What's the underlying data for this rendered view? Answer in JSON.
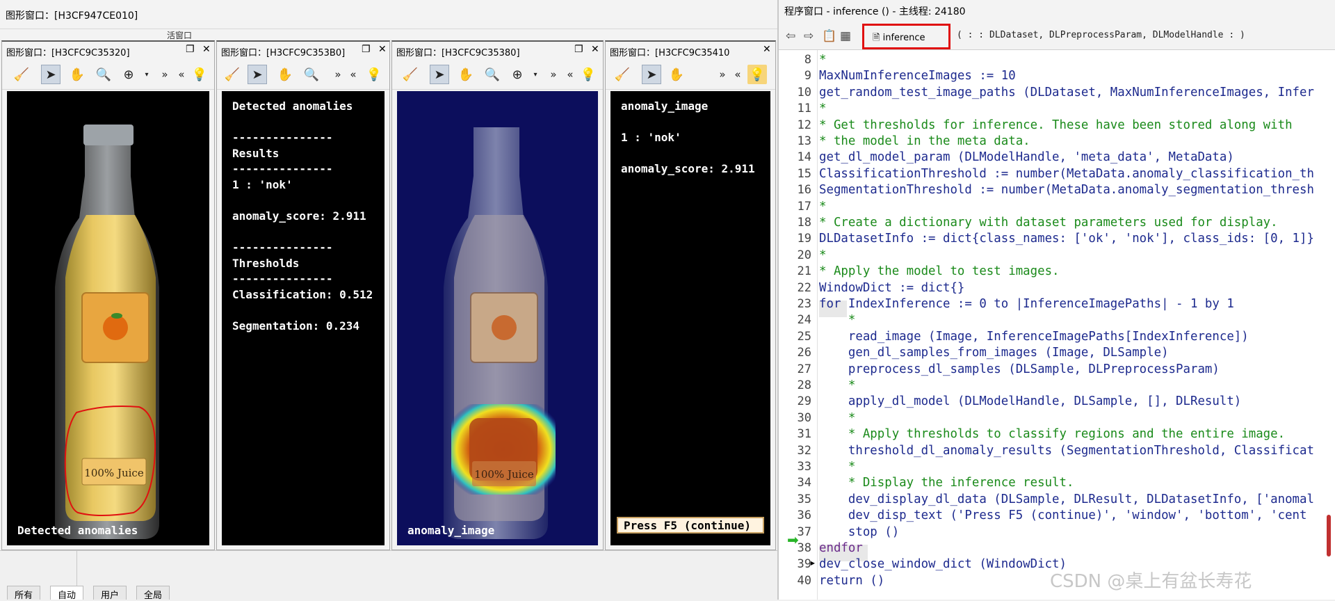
{
  "bg": {
    "title": "图形窗口：[H3CF947CE010]",
    "partial_label": "活窗口"
  },
  "windows": [
    {
      "title": "图形窗口：[H3CFC9C35320]",
      "caption": "Detected anomalies"
    },
    {
      "title": "图形窗口：[H3CFC9C353B0]",
      "lines": [
        "Detected anomalies",
        "",
        "---------------",
        "Results",
        "---------------",
        "1 : 'nok'",
        "",
        "anomaly_score: 2.911",
        "",
        "---------------",
        "Thresholds",
        "---------------",
        "Classification: 0.512",
        "",
        "Segmentation: 0.234"
      ]
    },
    {
      "title": "图形窗口：[H3CFC9C35380]",
      "caption": "anomaly_image"
    },
    {
      "title": "图形窗口：[H3CFC9C35410",
      "lines": [
        "anomaly_image",
        "",
        "1 : 'nok'",
        "",
        "anomaly_score: 2.911"
      ],
      "button": "Press F5 (continue)"
    }
  ],
  "bottom_tabs": [
    "所有",
    "自动",
    "用户",
    "全局"
  ],
  "bottle": {
    "label": "100% Juice"
  },
  "program": {
    "title": "程序窗口 - inference () - 主线程: 24180",
    "proc_name": "inference",
    "signature": "( : : DLDataset, DLPreprocessParam, DLModelHandle : )",
    "lines": [
      {
        "n": "8",
        "t": "*",
        "c": "cm"
      },
      {
        "n": "9",
        "t": "MaxNumInferenceImages := 10",
        "c": "var"
      },
      {
        "n": "10",
        "t": "get_random_test_image_paths (DLDataset, MaxNumInferenceImages, Infer",
        "c": "var"
      },
      {
        "n": "11",
        "t": "*",
        "c": "cm"
      },
      {
        "n": "12",
        "t": "* Get thresholds for inference. These have been stored along with",
        "c": "cm"
      },
      {
        "n": "13",
        "t": "* the model in the meta data.",
        "c": "cm"
      },
      {
        "n": "14",
        "t": "get_dl_model_param (DLModelHandle, 'meta_data', MetaData)",
        "c": "var"
      },
      {
        "n": "15",
        "t": "ClassificationThreshold := number(MetaData.anomaly_classification_th",
        "c": "var"
      },
      {
        "n": "16",
        "t": "SegmentationThreshold := number(MetaData.anomaly_segmentation_thresh",
        "c": "var"
      },
      {
        "n": "17",
        "t": "*",
        "c": "cm"
      },
      {
        "n": "18",
        "t": "* Create a dictionary with dataset parameters used for display.",
        "c": "cm"
      },
      {
        "n": "19",
        "t": "DLDatasetInfo := dict{class_names: ['ok', 'nok'], class_ids: [0, 1]}",
        "c": "var"
      },
      {
        "n": "20",
        "t": "*",
        "c": "cm"
      },
      {
        "n": "21",
        "t": "* Apply the model to test images.",
        "c": "cm"
      },
      {
        "n": "22",
        "t": "WindowDict := dict{}",
        "c": "var"
      },
      {
        "n": "23",
        "t": "for IndexInference := 0 to |InferenceImagePaths| - 1 by 1",
        "c": "var"
      },
      {
        "n": "24",
        "t": "    *",
        "c": "cm"
      },
      {
        "n": "25",
        "t": "    read_image (Image, InferenceImagePaths[IndexInference])",
        "c": "var"
      },
      {
        "n": "26",
        "t": "    gen_dl_samples_from_images (Image, DLSample)",
        "c": "var"
      },
      {
        "n": "27",
        "t": "    preprocess_dl_samples (DLSample, DLPreprocessParam)",
        "c": "var"
      },
      {
        "n": "28",
        "t": "    *",
        "c": "cm"
      },
      {
        "n": "29",
        "t": "    apply_dl_model (DLModelHandle, DLSample, [], DLResult)",
        "c": "var"
      },
      {
        "n": "30",
        "t": "    *",
        "c": "cm"
      },
      {
        "n": "31",
        "t": "    * Apply thresholds to classify regions and the entire image.",
        "c": "cm"
      },
      {
        "n": "32",
        "t": "    threshold_dl_anomaly_results (SegmentationThreshold, Classificat",
        "c": "var"
      },
      {
        "n": "33",
        "t": "    *",
        "c": "cm"
      },
      {
        "n": "34",
        "t": "    * Display the inference result.",
        "c": "cm"
      },
      {
        "n": "35",
        "t": "    dev_display_dl_data (DLSample, DLResult, DLDatasetInfo, ['anomal",
        "c": "var"
      },
      {
        "n": "36",
        "t": "    dev_disp_text ('Press F5 (continue)', 'window', 'bottom', 'cent",
        "c": "var"
      },
      {
        "n": "37",
        "t": "    stop ()",
        "c": "var"
      },
      {
        "n": "38",
        "t": "endfor",
        "c": "kw"
      },
      {
        "n": "39",
        "t": "dev_close_window_dict (WindowDict)",
        "c": "var"
      },
      {
        "n": "40",
        "t": "return ()",
        "c": "var"
      }
    ]
  },
  "watermark": "CSDN @桌上有盆长寿花"
}
